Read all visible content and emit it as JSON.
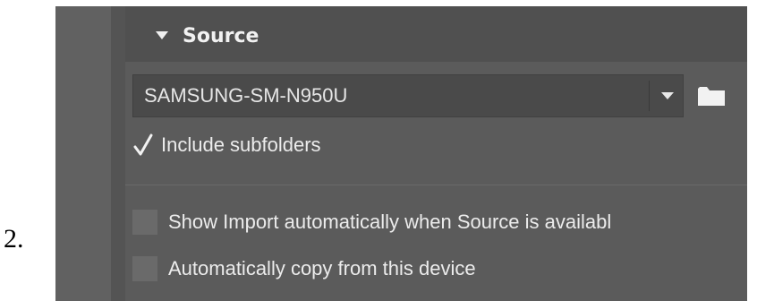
{
  "step": {
    "number": "2."
  },
  "section": {
    "title": "Source",
    "icon": "triangle-down-icon"
  },
  "source": {
    "selected": "SAMSUNG-SM-N950U",
    "dropdown_icon": "chevron-down-icon",
    "browse_icon": "folder-icon"
  },
  "options": {
    "include_subfolders": {
      "label": "Include subfolders",
      "checked": true
    },
    "show_import": {
      "label": "Show Import automatically when Source is availabl",
      "checked": false
    },
    "auto_copy": {
      "label": "Automatically copy from this device",
      "checked": false
    }
  },
  "colors": {
    "panel": "#5b5b5b",
    "header": "#505050",
    "text": "#ececec"
  }
}
